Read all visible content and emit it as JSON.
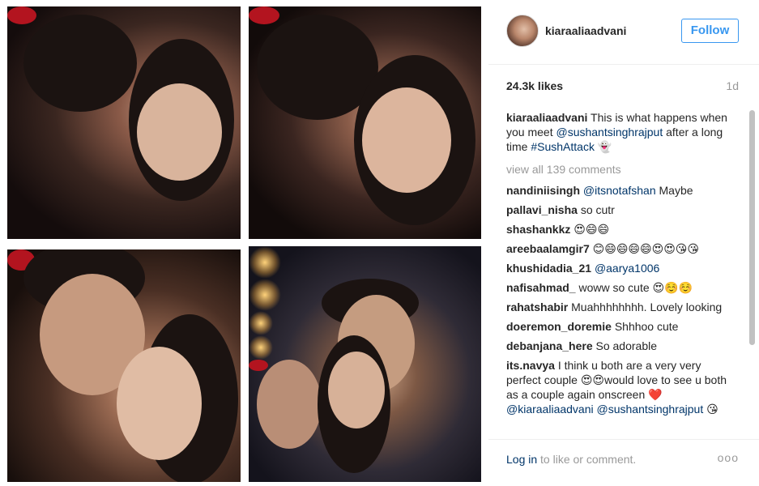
{
  "post": {
    "username": "kiaraaliaadvani",
    "follow_label": "Follow",
    "likes": "24.3k likes",
    "time": "1d",
    "caption": {
      "user": "kiaraaliaadvani",
      "text_1": "This is what happens when you meet",
      "mention": "@sushantsinghrajput",
      "text_2": "after a long time",
      "hashtag": "#SushAttack",
      "emoji": "👻"
    },
    "view_all": "view all 139 comments",
    "comments": [
      {
        "user": "nandiniisingh",
        "mention": "@itsnotafshan",
        "text": "Maybe"
      },
      {
        "user": "pallavi_nisha",
        "text": "so cutr"
      },
      {
        "user": "shashankkz",
        "text": "😍😄😄"
      },
      {
        "user": "areebaalamgir7",
        "text": "😊😄😄😄😄😍😍😘😘"
      },
      {
        "user": "khushidadia_21",
        "mention": "@aarya1006"
      },
      {
        "user": "nafisahmad_",
        "text": "woww so cute 😍☺️☺️"
      },
      {
        "user": "rahatshabir",
        "text": "Muahhhhhhhh. Lovely looking"
      },
      {
        "user": "doeremon_doremie",
        "text": "Shhhoo cute"
      },
      {
        "user": "debanjana_here",
        "text": "So adorable"
      },
      {
        "user": "its.navya",
        "text": "I think u both are a very very perfect couple 😍😍would love to see u both as a couple again onscreen ❤️",
        "mention": "@kiaraaliaadvani",
        "mention2": "@sushantsinghrajput",
        "emoji": "😘"
      }
    ],
    "footer": {
      "login": "Log in",
      "rest": " to like or comment.",
      "more": "ooo"
    }
  }
}
